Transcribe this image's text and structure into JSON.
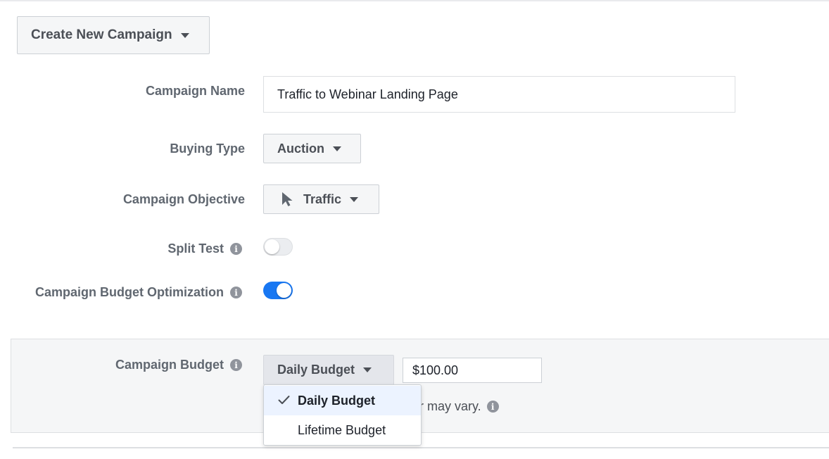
{
  "header": {
    "create_button_label": "Create New Campaign"
  },
  "form": {
    "campaign_name": {
      "label": "Campaign Name",
      "value": "Traffic to Webinar Landing Page"
    },
    "buying_type": {
      "label": "Buying Type",
      "selected": "Auction"
    },
    "objective": {
      "label": "Campaign Objective",
      "selected": "Traffic",
      "icon": "cursor-icon"
    },
    "split_test": {
      "label": "Split Test",
      "enabled": false
    },
    "budget_optimization": {
      "label": "Campaign Budget Optimization",
      "enabled": true
    }
  },
  "budget": {
    "label": "Campaign Budget",
    "type_selected": "Daily Budget",
    "amount": "$100.00",
    "note": "r may vary.",
    "dropdown": {
      "options": [
        "Daily Budget",
        "Lifetime Budget"
      ],
      "selected_index": 0
    }
  },
  "colors": {
    "accent": "#1877f2",
    "selected_bg": "#ecf3ff"
  }
}
